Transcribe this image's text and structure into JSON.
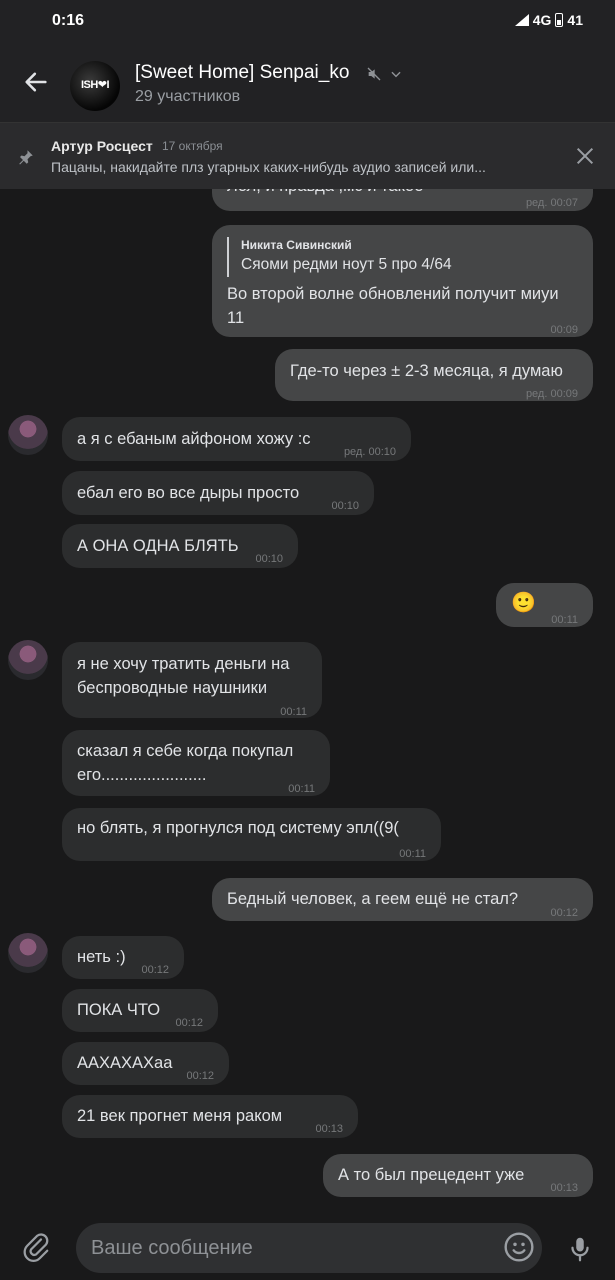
{
  "status": {
    "time": "0:16",
    "network": "4G",
    "battery": "41"
  },
  "header": {
    "title": "[Sweet Home] Senpai_ko",
    "subtitle": "29 участников",
    "avatar_text": "ISH❤I"
  },
  "pinned": {
    "author": "Артур Росцест",
    "date": "17 октября",
    "text": "Пацаны, накидайте плз угарных каких-нибудь аудио записей или..."
  },
  "messages": [
    {
      "side": "out",
      "text": "Лол, и правда ,мс и такое",
      "time": "ред. 00:07"
    },
    {
      "side": "out",
      "quote_author": "Никита Сивинский",
      "quote_text": "Сяоми редми ноут 5 про 4/64",
      "text": "Во второй волне обновлений получит миуи 11",
      "time": "00:09"
    },
    {
      "side": "out",
      "text": "Где-то через ± 2-3 месяца, я думаю",
      "time": "ред. 00:09"
    },
    {
      "side": "in",
      "text": "а я с ебаным айфоном хожу :с",
      "time": "ред. 00:10"
    },
    {
      "side": "in",
      "text": "ебал его во все дыры просто",
      "time": "00:10"
    },
    {
      "side": "in",
      "text": "А ОНА ОДНА БЛЯТЬ",
      "time": "00:10"
    },
    {
      "side": "out",
      "text": "🙂",
      "time": "00:11"
    },
    {
      "side": "in",
      "text": "я не хочу тратить деньги на беспроводные наушники",
      "time": "00:11"
    },
    {
      "side": "in",
      "text": "сказал я себе когда покупал его.......................",
      "time": "00:11"
    },
    {
      "side": "in",
      "text": "но блять, я прогнулся под систему эпл((9(",
      "time": "00:11"
    },
    {
      "side": "out",
      "text": "Бедный человек, а геем ещё не стал?",
      "time": "00:12"
    },
    {
      "side": "in",
      "text": "неть :)",
      "time": "00:12"
    },
    {
      "side": "in",
      "text": "ПОКА ЧТО",
      "time": "00:12"
    },
    {
      "side": "in",
      "text": "ААХАХАХаа",
      "time": "00:12"
    },
    {
      "side": "in",
      "text": "21 век прогнет меня раком",
      "time": "00:13"
    },
    {
      "side": "out",
      "text": "А то был прецедент уже",
      "time": "00:13"
    }
  ],
  "composer": {
    "placeholder": "Ваше сообщение"
  },
  "colors": {
    "background": "#19191a",
    "bar": "#222224",
    "bubble_out": "#454647",
    "bubble_in": "#2c2d2e"
  }
}
